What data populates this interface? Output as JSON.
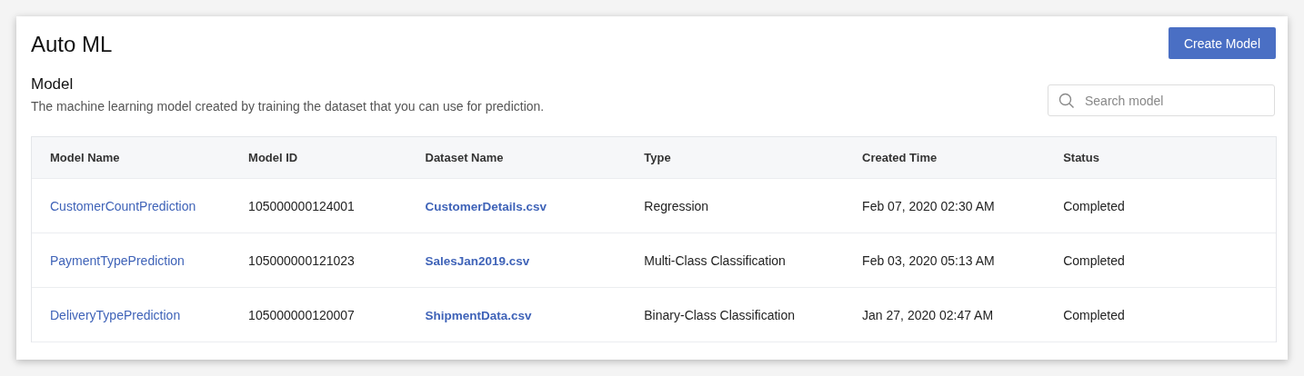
{
  "page": {
    "title": "Auto ML",
    "create_button": "Create Model"
  },
  "section": {
    "title": "Model",
    "description": "The machine learning model created by training the dataset that you can use for prediction.",
    "search": {
      "placeholder": "Search model"
    }
  },
  "table": {
    "columns": [
      {
        "label": "Model Name",
        "kind": "link"
      },
      {
        "label": "Model ID",
        "kind": "text"
      },
      {
        "label": "Dataset Name",
        "kind": "file"
      },
      {
        "label": "Type",
        "kind": "text"
      },
      {
        "label": "Created Time",
        "kind": "text"
      },
      {
        "label": "Status",
        "kind": "text"
      }
    ],
    "rows": [
      [
        "CustomerCountPrediction",
        "105000000124001",
        "CustomerDetails.csv",
        "Regression",
        "Feb 07, 2020 02:30 AM",
        "Completed"
      ],
      [
        "PaymentTypePrediction",
        "105000000121023",
        "SalesJan2019.csv",
        "Multi-Class Classification",
        "Feb 03, 2020 05:13 AM",
        "Completed"
      ],
      [
        "DeliveryTypePrediction",
        "105000000120007",
        "ShipmentData.csv",
        "Binary-Class Classification",
        "Jan 27, 2020 02:47 AM",
        "Completed"
      ]
    ]
  }
}
